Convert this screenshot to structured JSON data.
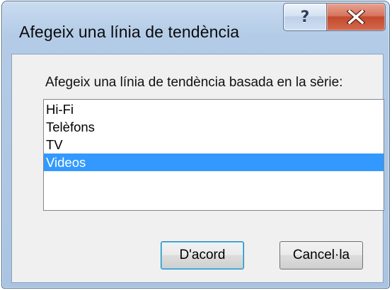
{
  "window": {
    "title": "Afegeix una línia de tendència"
  },
  "titlebar": {
    "help_glyph": "?",
    "help_icon": "help-question-icon",
    "close_icon": "close-x-icon"
  },
  "dialog": {
    "prompt": "Afegeix una línia de tendència basada en la sèrie:",
    "series": [
      {
        "label": "Hi-Fi",
        "selected": false
      },
      {
        "label": "Telèfons",
        "selected": false
      },
      {
        "label": "TV",
        "selected": false
      },
      {
        "label": "Videos",
        "selected": true
      }
    ],
    "ok_label": "D'acord",
    "cancel_label": "Cancel·la"
  },
  "colors": {
    "selection": "#3399ff",
    "close_button": "#c24a2f",
    "frame": "#a9c4e2"
  }
}
